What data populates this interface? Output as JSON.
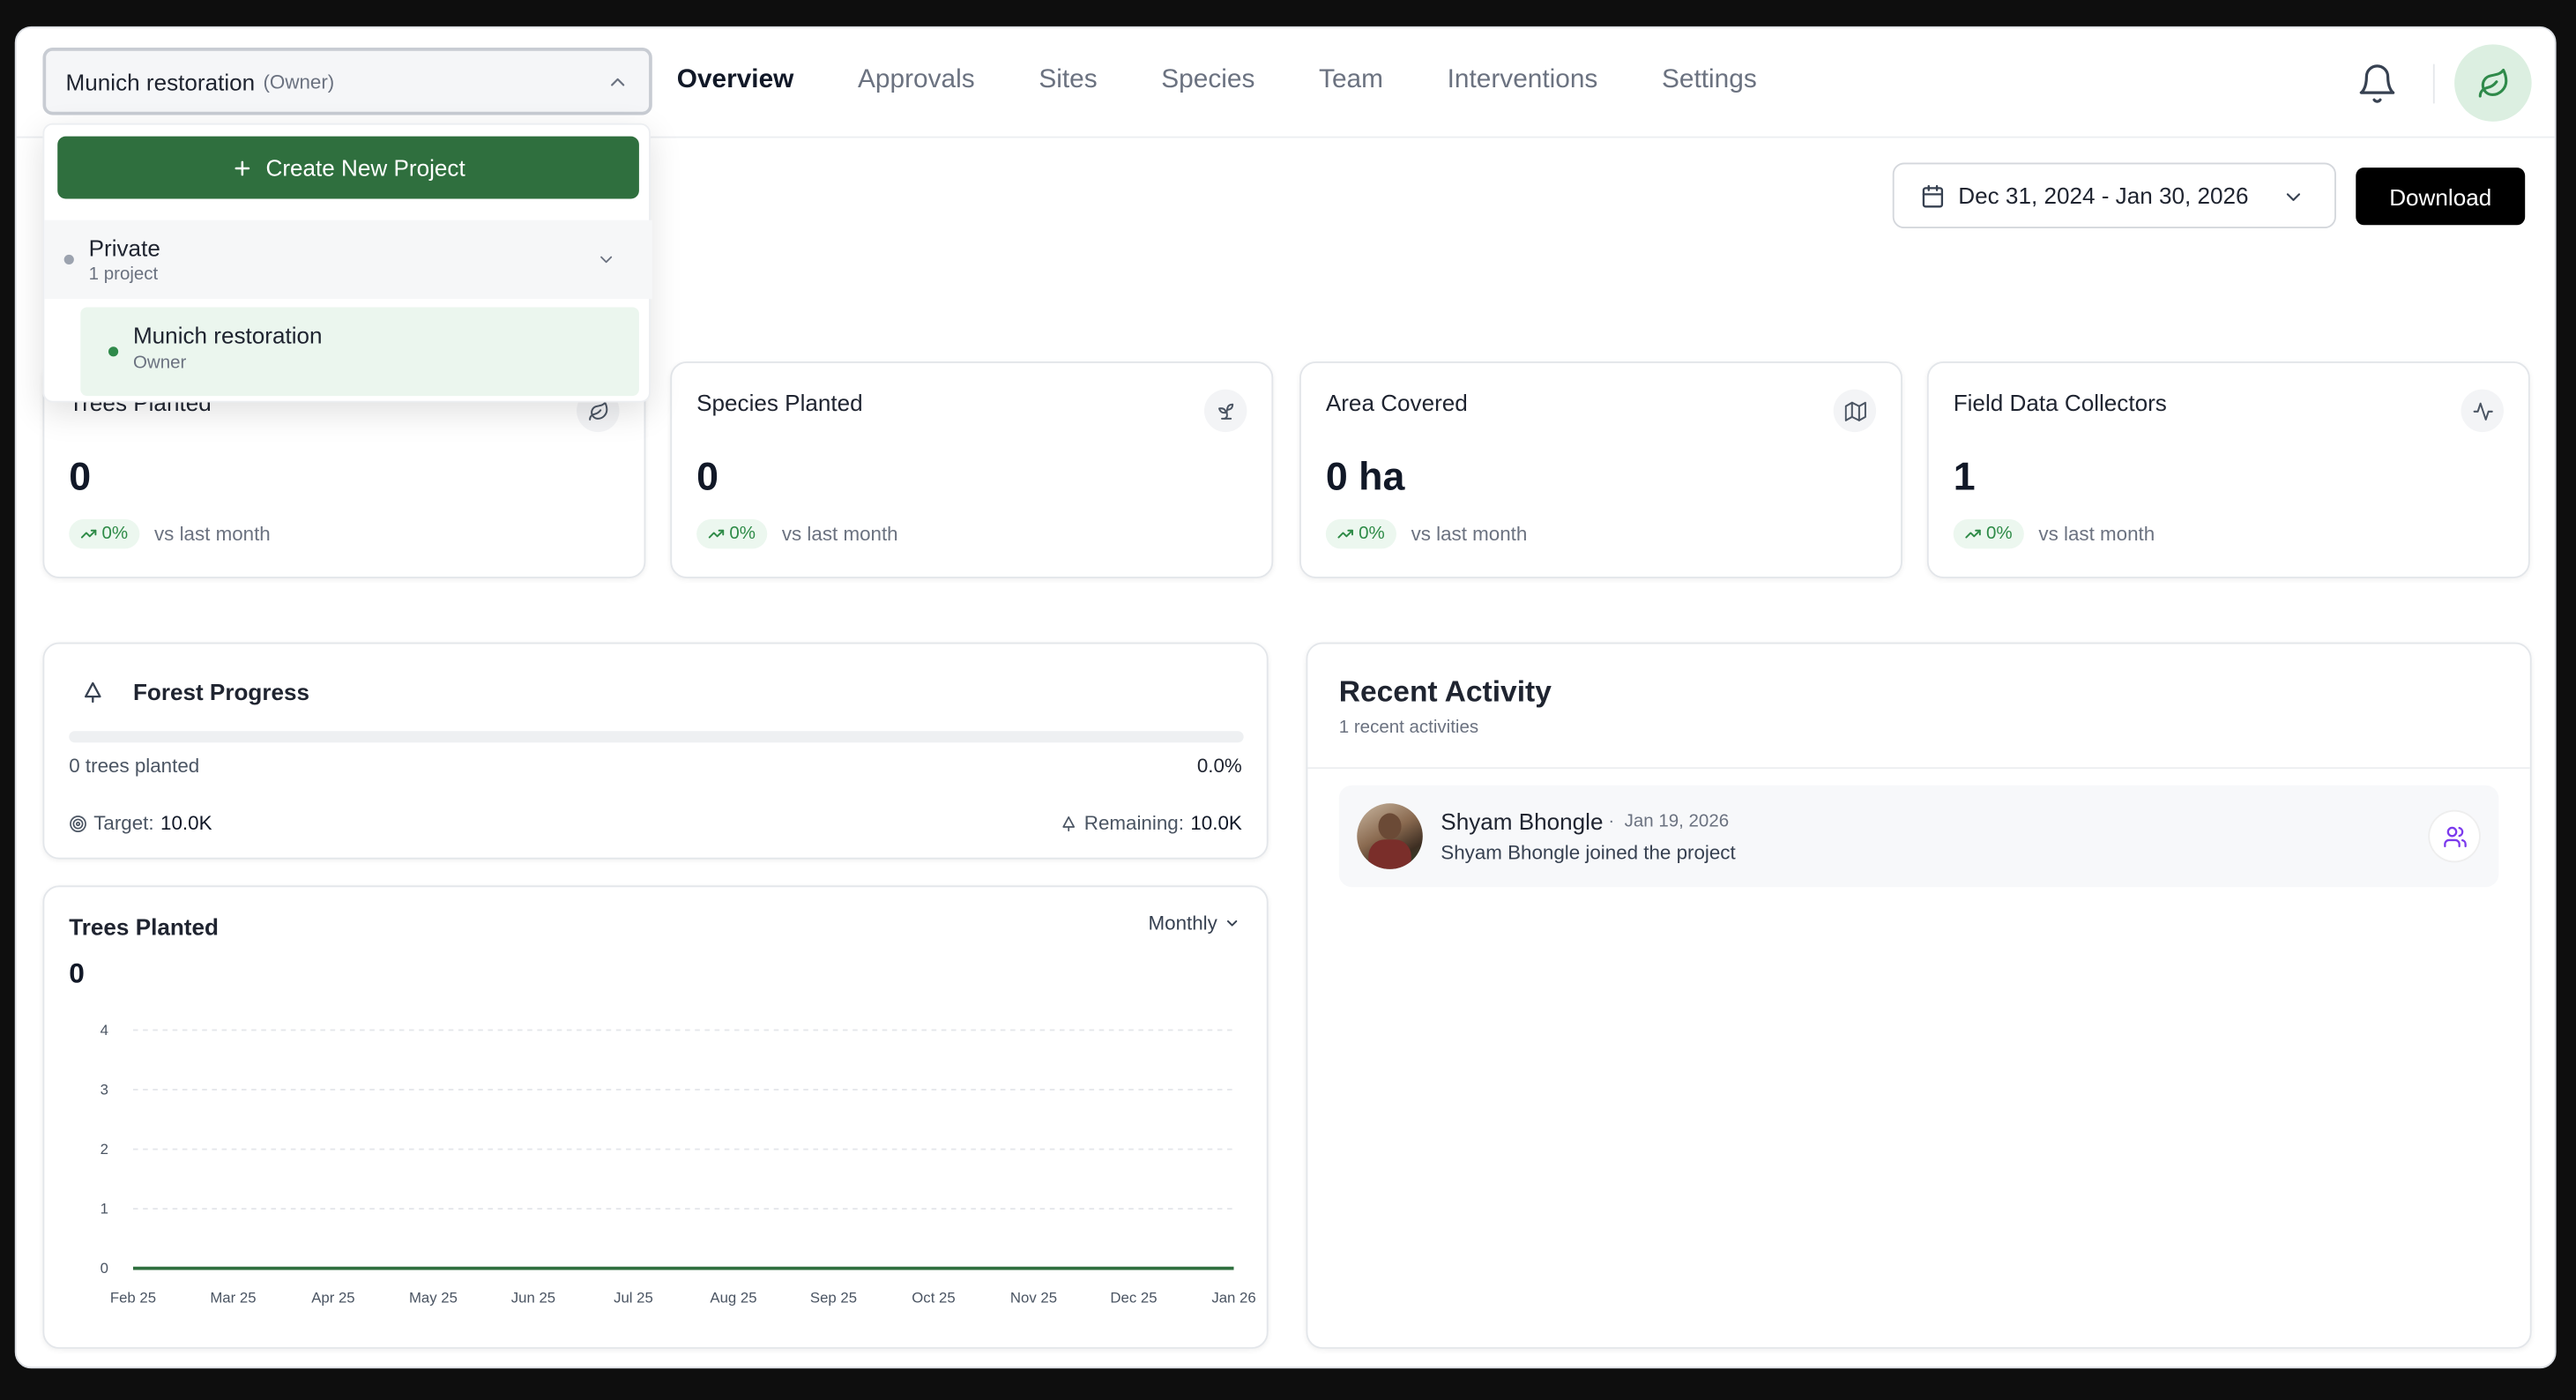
{
  "header": {
    "project_name": "Munich restoration",
    "project_role": "(Owner)",
    "tabs": [
      {
        "label": "Overview",
        "active": true
      },
      {
        "label": "Approvals",
        "active": false
      },
      {
        "label": "Sites",
        "active": false
      },
      {
        "label": "Species",
        "active": false
      },
      {
        "label": "Team",
        "active": false
      },
      {
        "label": "Interventions",
        "active": false
      },
      {
        "label": "Settings",
        "active": false
      }
    ],
    "icons": [
      "chevron-up-icon",
      "bell-icon",
      "leaf-icon"
    ]
  },
  "project_menu": {
    "create_label": "Create New Project",
    "group_name": "Private",
    "group_count": "1 project",
    "project_name": "Munich restoration",
    "project_role": "Owner"
  },
  "toolbar": {
    "date_range": "Dec 31, 2024 - Jan 30, 2026",
    "download_label": "Download"
  },
  "stats": [
    {
      "title": "Trees Planted",
      "value": "0",
      "trend": "0%",
      "trend_label": "vs last month",
      "icon": "leaf-icon"
    },
    {
      "title": "Species Planted",
      "value": "0",
      "trend": "0%",
      "trend_label": "vs last month",
      "icon": "sprout-icon"
    },
    {
      "title": "Area Covered",
      "value": "0 ha",
      "trend": "0%",
      "trend_label": "vs last month",
      "icon": "map-icon"
    },
    {
      "title": "Field Data Collectors",
      "value": "1",
      "trend": "0%",
      "trend_label": "vs last month",
      "icon": "activity-icon"
    }
  ],
  "forest_progress": {
    "title": "Forest Progress",
    "planted_label": "0 trees planted",
    "percent": "0.0%",
    "progress_fraction": 0,
    "target_label": "Target:",
    "target_value": "10.0K",
    "remaining_label": "Remaining:",
    "remaining_value": "10.0K"
  },
  "trees_chart": {
    "title": "Trees Planted",
    "total": "0",
    "period": "Monthly"
  },
  "chart_data": {
    "type": "line",
    "x": [
      "Feb 25",
      "Mar 25",
      "Apr 25",
      "May 25",
      "Jun 25",
      "Jul 25",
      "Aug 25",
      "Sep 25",
      "Oct 25",
      "Nov 25",
      "Dec 25",
      "Jan 26"
    ],
    "series": [
      {
        "values": [
          0,
          0,
          0,
          0,
          0,
          0,
          0,
          0,
          0,
          0,
          0,
          0
        ]
      }
    ],
    "y_ticks": [
      "0",
      "1",
      "2",
      "3",
      "4"
    ],
    "ylim": [
      0,
      4
    ],
    "grid": true,
    "color": "#2f6f3e"
  },
  "recent_activity": {
    "title": "Recent Activity",
    "subtitle": "1 recent activities",
    "items": [
      {
        "name": "Shyam Bhongle",
        "date": "Jan 19, 2026",
        "description": "Shyam Bhongle joined the project",
        "icon": "users-icon"
      }
    ]
  },
  "colors": {
    "brand_green": "#2f6f3e",
    "trend_green": "#2e8b47",
    "activity_icon": "#7c3aed"
  }
}
